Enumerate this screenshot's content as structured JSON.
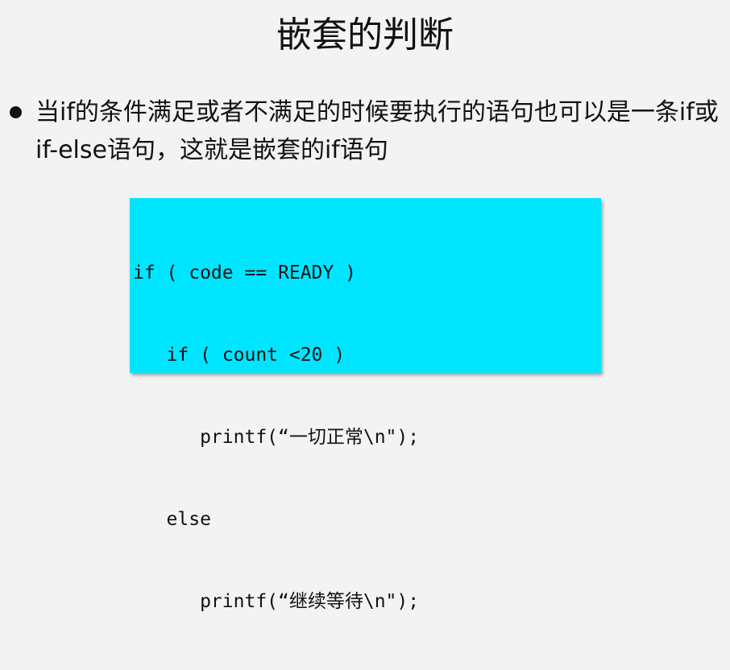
{
  "slide": {
    "title": "嵌套的判断",
    "bullet": "当if的条件满足或者不满足的时候要执行的语句也可以是一条if或if-else语句，这就是嵌套的if语句",
    "code_lines": [
      "if ( code == READY )",
      "   if ( count <20 )",
      "      printf(“一切正常\\n\");",
      "   else",
      "      printf(“继续等待\\n\");"
    ],
    "colors": {
      "code_background": "#00e5ff",
      "slide_background": "#f3f3f3"
    }
  }
}
